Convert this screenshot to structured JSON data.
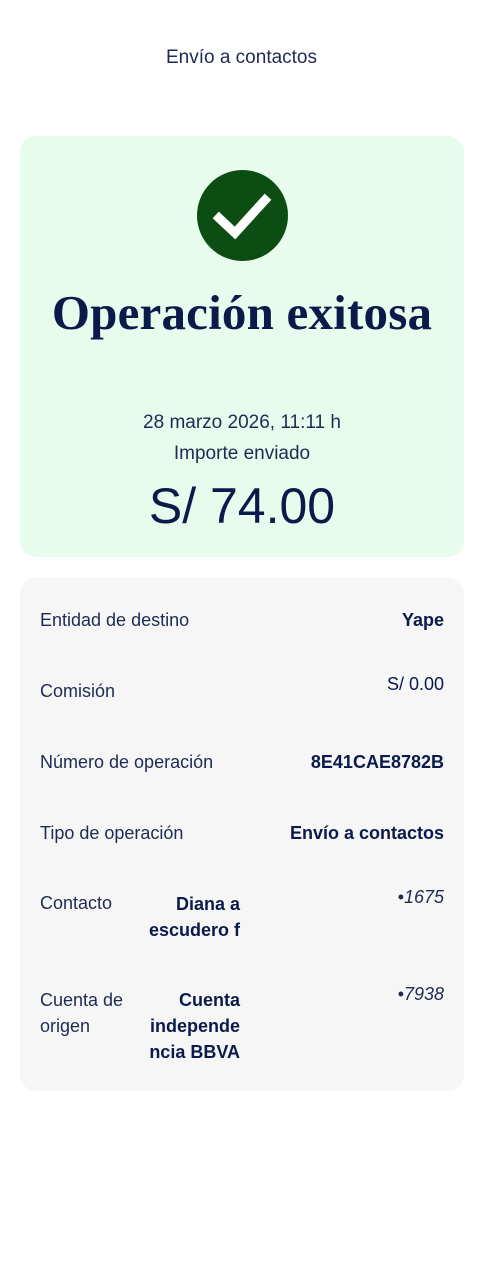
{
  "header": {
    "title": "Envío a contactos"
  },
  "success": {
    "icon": "check-icon",
    "title": "Operación exitosa",
    "date": "28 marzo 2026, 11:11 h",
    "amount_label": "Importe enviado",
    "amount": "S/ 74.00",
    "accent_color": "#0b4d12",
    "card_color": "#e8fced"
  },
  "details": {
    "entidad_label": "Entidad de destino",
    "entidad_value": "Yape",
    "comision_label": "Comisión",
    "comision_value": "S/ 0.00",
    "numero_label": "Número de operación",
    "numero_value": "8E41CAE8782B",
    "tipo_label": "Tipo de operación",
    "tipo_value": "Envío a contactos",
    "contacto_label": "Contacto",
    "contacto_name_line1": "Diana a",
    "contacto_name_line2": "escudero f",
    "contacto_number": "•1675",
    "cuenta_label_line1": "Cuenta de",
    "cuenta_label_line2": "origen",
    "cuenta_name_line1": "Cuenta",
    "cuenta_name_line2": "independe",
    "cuenta_name_line3": "ncia BBVA",
    "cuenta_number": "•7938"
  }
}
